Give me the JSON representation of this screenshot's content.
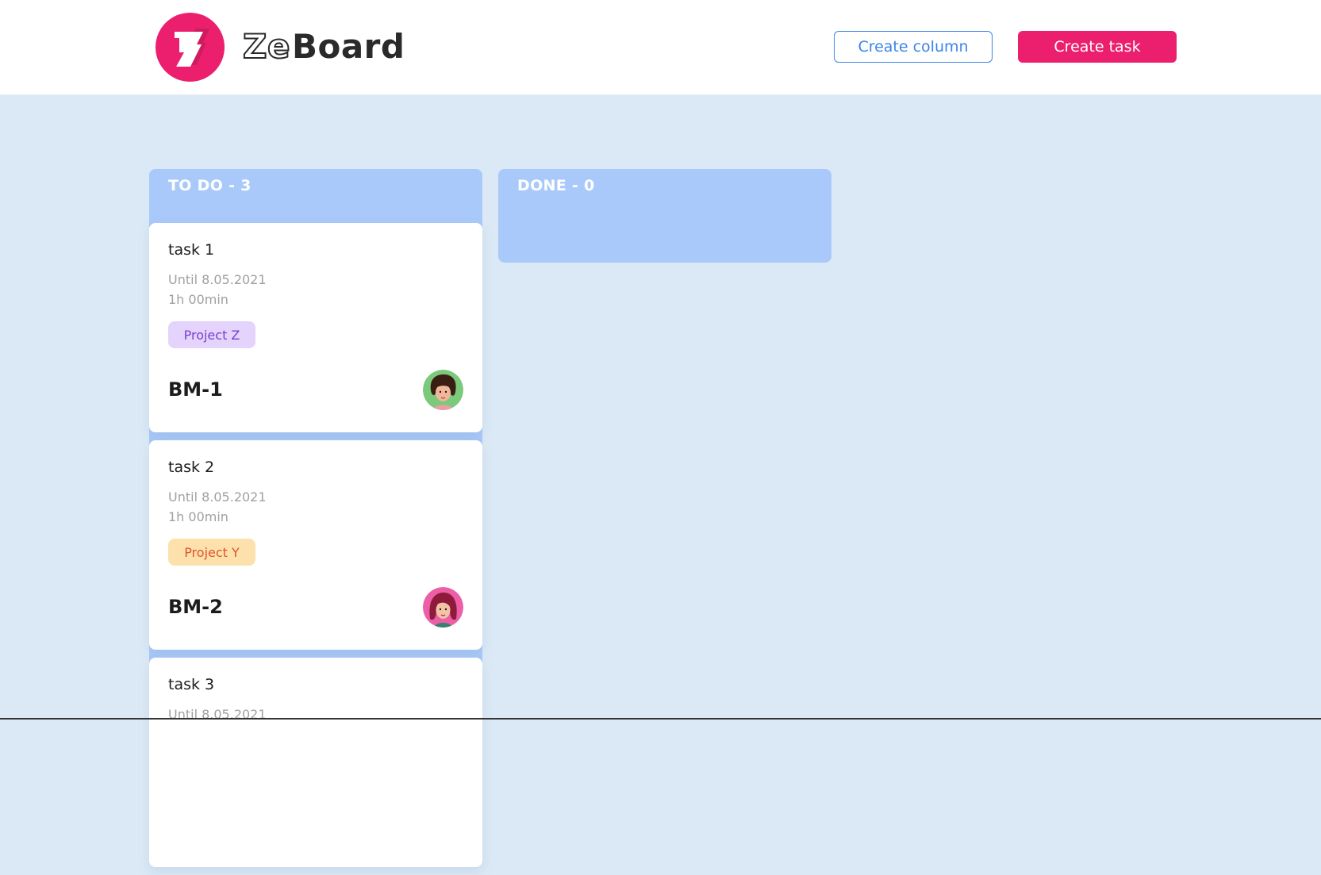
{
  "header": {
    "brand_prefix": "Ze",
    "brand_suffix": "Board",
    "create_column_label": "Create column",
    "create_task_label": "Create task"
  },
  "colors": {
    "brand_pink": "#ec1f6e",
    "accent_blue": "#3a86e8",
    "column_bg": "#a9c9fa",
    "page_bg": "#dbe9f6"
  },
  "columns": [
    {
      "title": "TO DO - 3",
      "cards": [
        {
          "title": "task 1",
          "until": "Until 8.05.2021",
          "duration": "1h 00min",
          "tag": "Project Z",
          "tag_bg": "#e4d4fb",
          "tag_color": "#7b3fd0",
          "id": "BM-1",
          "avatar_icon": "woman-avatar-green"
        },
        {
          "title": "task 2",
          "until": "Until 8.05.2021",
          "duration": "1h 00min",
          "tag": "Project Y",
          "tag_bg": "#fde1ad",
          "tag_color": "#e1532c",
          "id": "BM-2",
          "avatar_icon": "woman-avatar-pink"
        },
        {
          "title": "task 3",
          "until": "Until 8.05.2021"
        }
      ]
    },
    {
      "title": "DONE - 0",
      "cards": []
    }
  ]
}
